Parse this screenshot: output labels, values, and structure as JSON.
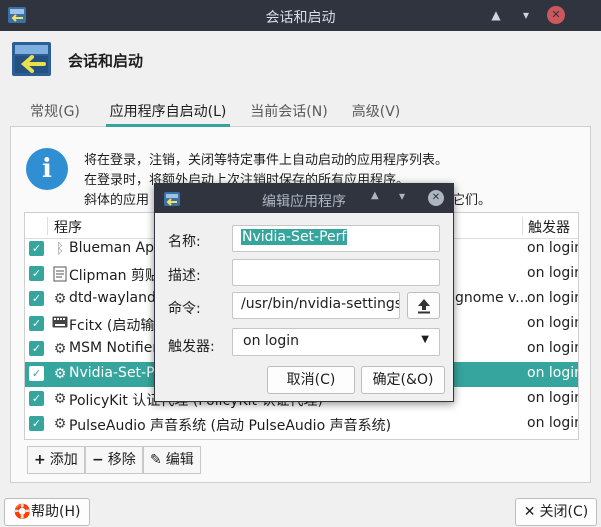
{
  "window": {
    "title": "会话和启动",
    "controls": [
      "collapse-icon",
      "minimize-icon",
      "close-icon"
    ]
  },
  "header": {
    "title": "会话和启动"
  },
  "tabs": [
    {
      "label": "常规(G)",
      "active": false
    },
    {
      "label": "应用程序自启动(L)",
      "active": true
    },
    {
      "label": "当前会话(N)",
      "active": false
    },
    {
      "label": "高级(V)",
      "active": false
    }
  ],
  "info": {
    "line1": "将在登录，注销，关闭等特定事件上自动启动的应用程序列表。",
    "line2": "在登录时，将额外启动上次注销时保存的所有应用程序。",
    "line3": "斜体的应用",
    "line3_tail": "它们。"
  },
  "list": {
    "columns": {
      "program": "程序",
      "trigger": "触发器"
    },
    "rows": [
      {
        "name": "Blueman Appl",
        "trigger": "on login",
        "checked": true,
        "icon": "bluetooth-icon",
        "selected": false
      },
      {
        "name": "Clipman 剪贴板",
        "trigger": "on login",
        "checked": true,
        "icon": "clipboard-icon",
        "selected": false
      },
      {
        "name": "dtd-wayland (W",
        "name_tail": "gnome v...",
        "trigger": "on login",
        "checked": true,
        "icon": "gear-icon",
        "selected": false
      },
      {
        "name": "Fcitx (启动输入",
        "trigger": "on login",
        "checked": true,
        "icon": "keyboard-icon",
        "selected": false
      },
      {
        "name": "MSM Notifier",
        "trigger": "on login",
        "checked": true,
        "icon": "gear-icon",
        "selected": false
      },
      {
        "name": "Nvidia-Set-Per",
        "trigger": "on login",
        "checked": true,
        "icon": "gear-icon",
        "selected": true
      },
      {
        "name": "PolicyKit 认证代理 (PolicyKit 认证代理)",
        "trigger": "on login",
        "checked": true,
        "icon": "gear-icon",
        "selected": false
      },
      {
        "name": "PulseAudio 声音系统 (启动 PulseAudio 声音系统)",
        "trigger": "on login",
        "checked": true,
        "icon": "gear-icon",
        "selected": false
      }
    ]
  },
  "toolbar": {
    "add_label": "添加",
    "remove_label": "移除",
    "edit_label": "编辑"
  },
  "footer": {
    "help_label": "帮助(H)",
    "close_label": "关闭(C)"
  },
  "dialog": {
    "title": "编辑应用程序",
    "name_label": "名称:",
    "name_value": "Nvidia-Set-Perf",
    "desc_label": "描述:",
    "desc_value": "",
    "cmd_label": "命令:",
    "cmd_value": "/usr/bin/nvidia-settings -",
    "trigger_label": "触发器:",
    "trigger_value": "on login",
    "cancel_label": "取消(C)",
    "ok_label": "确定(&O)"
  },
  "colors": {
    "accent": "#36a59d",
    "titlebar": "#2f343f",
    "info": "#2f8fd2",
    "close": "#cc575d"
  }
}
